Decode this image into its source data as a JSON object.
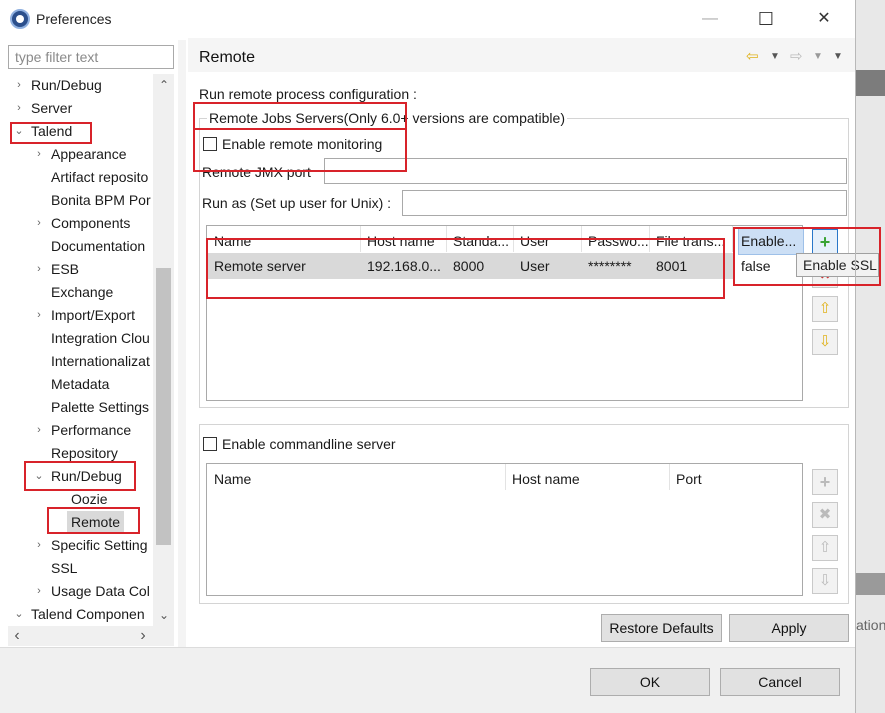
{
  "window": {
    "title": "Preferences",
    "controls": {
      "minimize": "—",
      "maximize": "☐",
      "close": "✕"
    }
  },
  "sidebar": {
    "filter_placeholder": "type filter text",
    "items": [
      {
        "label": "Run/Debug",
        "chevron": "›"
      },
      {
        "label": "Server",
        "chevron": "›"
      },
      {
        "label": "Talend",
        "chevron": "⌄"
      },
      {
        "label": "Appearance",
        "chevron": "›"
      },
      {
        "label": "Artifact reposito",
        "chevron": ""
      },
      {
        "label": "Bonita BPM Por",
        "chevron": ""
      },
      {
        "label": "Components",
        "chevron": "›"
      },
      {
        "label": "Documentation",
        "chevron": ""
      },
      {
        "label": "ESB",
        "chevron": "›"
      },
      {
        "label": "Exchange",
        "chevron": ""
      },
      {
        "label": "Import/Export",
        "chevron": "›"
      },
      {
        "label": "Integration Clou",
        "chevron": ""
      },
      {
        "label": "Internationalizat",
        "chevron": ""
      },
      {
        "label": "Metadata",
        "chevron": ""
      },
      {
        "label": "Palette Settings",
        "chevron": ""
      },
      {
        "label": "Performance",
        "chevron": "›"
      },
      {
        "label": "Repository",
        "chevron": ""
      },
      {
        "label": "Run/Debug",
        "chevron": "⌄"
      },
      {
        "label": "Oozie",
        "chevron": ""
      },
      {
        "label": "Remote",
        "chevron": ""
      },
      {
        "label": "Specific Setting",
        "chevron": "›"
      },
      {
        "label": "SSL",
        "chevron": ""
      },
      {
        "label": "Usage Data Col",
        "chevron": "›"
      },
      {
        "label": "Talend Componen",
        "chevron": "⌄"
      }
    ],
    "scroll_left": "‹",
    "scroll_right": "›"
  },
  "page": {
    "title": "Remote",
    "run_remote_label": "Run remote process configuration :",
    "remote_jobs_group": "Remote Jobs Servers(Only 6.0+ versions are compatible)",
    "enable_remote_monitoring": "Enable remote monitoring",
    "remote_jmx_port_label": "Remote JMX port",
    "remote_jmx_port_value": "",
    "run_as_label": "Run as (Set up user for Unix) :",
    "run_as_value": "",
    "servers_table": {
      "headers": [
        "Name",
        "Host name",
        "Standa...",
        "User",
        "Passwo...",
        "File trans...",
        "Enable..."
      ],
      "rows": [
        [
          "Remote server",
          "192.168.0...",
          "8000",
          "User",
          "********",
          "8001",
          "false"
        ]
      ]
    },
    "tooltip": "Enable SSL",
    "enable_commandline": "Enable commandline server",
    "commandline_table": {
      "headers": [
        "Name",
        "Host name",
        "Port"
      ]
    },
    "buttons": {
      "restore_defaults": "Restore Defaults",
      "apply": "Apply",
      "ok": "OK",
      "cancel": "Cancel"
    },
    "background_fragment": "ation"
  },
  "colors": {
    "highlight_red": "#d8232a",
    "selected_row": "#d9d9d9",
    "header_selected": "#ccdff5",
    "add_icon_green": "#3aa335",
    "arrow_icon_yellow": "#e0b21b"
  }
}
